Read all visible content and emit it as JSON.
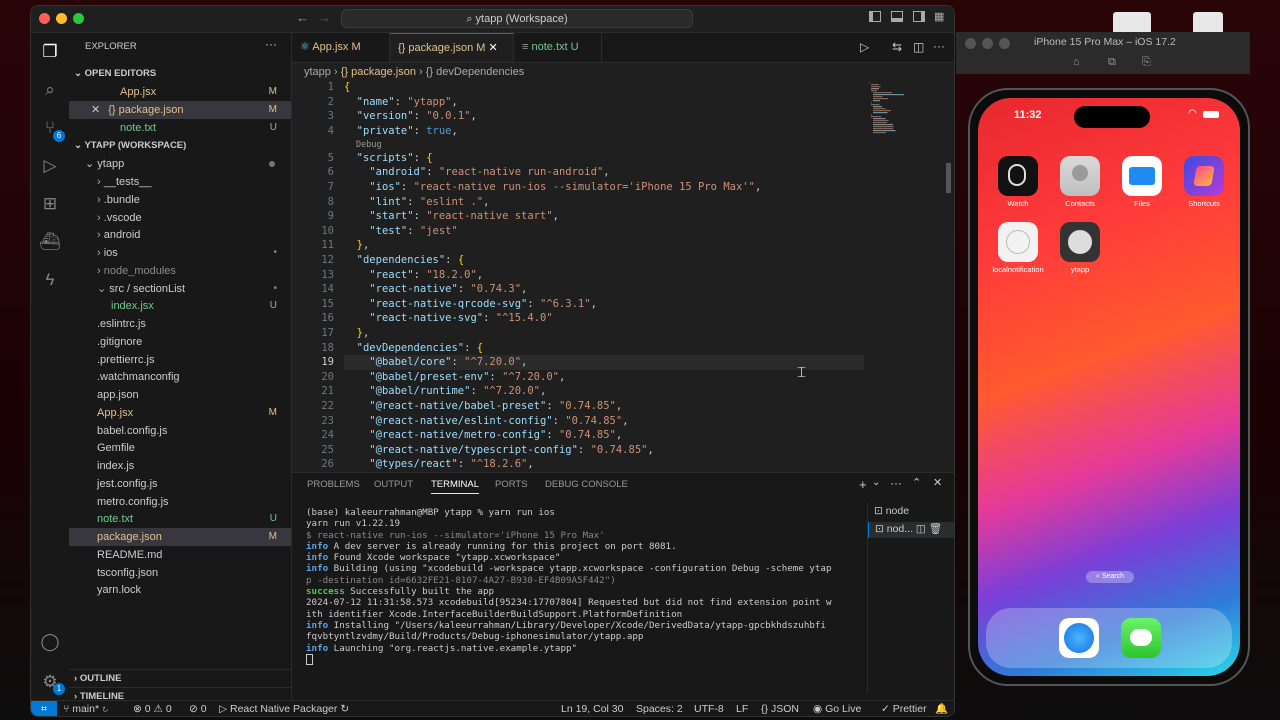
{
  "vscode": {
    "title": "ytapp (Workspace)",
    "tabs": [
      {
        "label": "App.jsx",
        "status": "M"
      },
      {
        "label": "package.json",
        "status": "M"
      },
      {
        "label": "note.txt",
        "status": "U"
      }
    ],
    "breadcrumb": [
      "ytapp",
      "{} package.json",
      "{} devDependencies"
    ],
    "explorer": {
      "title": "EXPLORER",
      "open_editors_label": "OPEN EDITORS",
      "open_editors": [
        {
          "name": "App.jsx",
          "status": "M"
        },
        {
          "name": "package.json",
          "status": "M"
        },
        {
          "name": "note.txt",
          "status": "U"
        }
      ],
      "workspace_label": "YTAPP (WORKSPACE)",
      "root": "ytapp",
      "items": [
        {
          "name": "__tests__",
          "status": ""
        },
        {
          "name": ".bundle",
          "status": ""
        },
        {
          "name": ".vscode",
          "status": ""
        },
        {
          "name": "android",
          "status": ""
        },
        {
          "name": "ios",
          "status": "•"
        },
        {
          "name": "node_modules",
          "status": ""
        },
        {
          "name": "src / sectionList",
          "status": "•"
        },
        {
          "name": "index.jsx",
          "status": "U"
        },
        {
          "name": ".eslintrc.js",
          "status": ""
        },
        {
          "name": ".gitignore",
          "status": ""
        },
        {
          "name": ".prettierrc.js",
          "status": ""
        },
        {
          "name": ".watchmanconfig",
          "status": ""
        },
        {
          "name": "app.json",
          "status": ""
        },
        {
          "name": "App.jsx",
          "status": "M"
        },
        {
          "name": "babel.config.js",
          "status": ""
        },
        {
          "name": "Gemfile",
          "status": ""
        },
        {
          "name": "index.js",
          "status": ""
        },
        {
          "name": "jest.config.js",
          "status": ""
        },
        {
          "name": "metro.config.js",
          "status": ""
        },
        {
          "name": "note.txt",
          "status": "U"
        },
        {
          "name": "package.json",
          "status": "M"
        },
        {
          "name": "README.md",
          "status": ""
        },
        {
          "name": "tsconfig.json",
          "status": ""
        },
        {
          "name": "yarn.lock",
          "status": ""
        }
      ],
      "outline_label": "OUTLINE",
      "timeline_label": "TIMELINE"
    },
    "code_lines": [
      "{",
      "  \"name\": \"ytapp\",",
      "  \"version\": \"0.0.1\",",
      "  \"private\": true,",
      "  \"scripts\": {",
      "    \"android\": \"react-native run-android\",",
      "    \"ios\": \"react-native run-ios --simulator='iPhone 15 Pro Max'\",",
      "    \"lint\": \"eslint .\",",
      "    \"start\": \"react-native start\",",
      "    \"test\": \"jest\"",
      "  },",
      "  \"dependencies\": {",
      "    \"react\": \"18.2.0\",",
      "    \"react-native\": \"0.74.3\",",
      "    \"react-native-qrcode-svg\": \"^6.3.1\",",
      "    \"react-native-svg\": \"^15.4.0\"",
      "  },",
      "  \"devDependencies\": {",
      "    \"@babel/core\": \"^7.20.0\",",
      "    \"@babel/preset-env\": \"^7.20.0\",",
      "    \"@babel/runtime\": \"^7.20.0\",",
      "    \"@react-native/babel-preset\": \"0.74.85\",",
      "    \"@react-native/eslint-config\": \"0.74.85\",",
      "    \"@react-native/metro-config\": \"0.74.85\",",
      "    \"@react-native/typescript-config\": \"0.74.85\",",
      "    \"@types/react\": \"^18.2.6\","
    ],
    "codelens": "Debug",
    "panel_tabs": [
      "PROBLEMS",
      "OUTPUT",
      "TERMINAL",
      "PORTS",
      "DEBUG CONSOLE"
    ],
    "terminal_lines": [
      {
        "kind": "plain",
        "text": "(base) kaleeurrahman@MBP ytapp % yarn run ios"
      },
      {
        "kind": "plain",
        "text": "yarn run v1.22.19"
      },
      {
        "kind": "dim",
        "text": "$ react-native run-ios --simulator='iPhone 15 Pro Max'"
      },
      {
        "kind": "info",
        "label": "info",
        "text": " A dev server is already running for this project on port 8081."
      },
      {
        "kind": "info",
        "label": "info",
        "text": " Found Xcode workspace \"ytapp.xcworkspace\""
      },
      {
        "kind": "info",
        "label": "info",
        "text": " Building (using \"xcodebuild -workspace ytapp.xcworkspace -configuration Debug -scheme ytap"
      },
      {
        "kind": "dim",
        "text": "p -destination id=6632FE21-8107-4A27-B930-EF4B09A5F442\")"
      },
      {
        "kind": "success",
        "label": "success",
        "text": " Successfully built the app"
      },
      {
        "kind": "plain",
        "text": "2024-07-12 11:31:58.573 xcodebuild[95234:17707804] Requested but did not find extension point w"
      },
      {
        "kind": "plain",
        "text": "ith identifier Xcode.InterfaceBuilderBuildSupport.PlatformDefinition"
      },
      {
        "kind": "info",
        "label": "info",
        "text": " Installing \"/Users/kaleeurrahman/Library/Developer/Xcode/DerivedData/ytapp-gpcbkhdszuhbfi"
      },
      {
        "kind": "plain",
        "text": "fqvbtyntlzvdmy/Build/Products/Debug-iphonesimulator/ytapp.app"
      },
      {
        "kind": "info",
        "label": "info",
        "text": " Launching \"org.reactjs.native.example.ytapp\""
      }
    ],
    "terminal_instances": [
      "node",
      "nod..."
    ],
    "status": {
      "branch": "main*",
      "errors": "0",
      "warnings": "0",
      "ports": "0",
      "packager": "React Native Packager",
      "position": "Ln 19, Col 30",
      "spaces": "Spaces: 2",
      "encoding": "UTF-8",
      "eol": "LF",
      "language": "JSON",
      "golive": "Go Live",
      "prettier": "Prettier"
    }
  },
  "simulator": {
    "title": "iPhone 15 Pro Max – iOS 17.2",
    "time": "11:32",
    "apps_row1": [
      "Watch",
      "Contacts",
      "Files",
      "Shortcuts"
    ],
    "apps_row2": [
      "localnotification",
      "ytapp"
    ],
    "search_label": "Search"
  },
  "colors": {
    "accent": "#0078d4",
    "modified": "#e2c08d",
    "untracked": "#73c991"
  }
}
